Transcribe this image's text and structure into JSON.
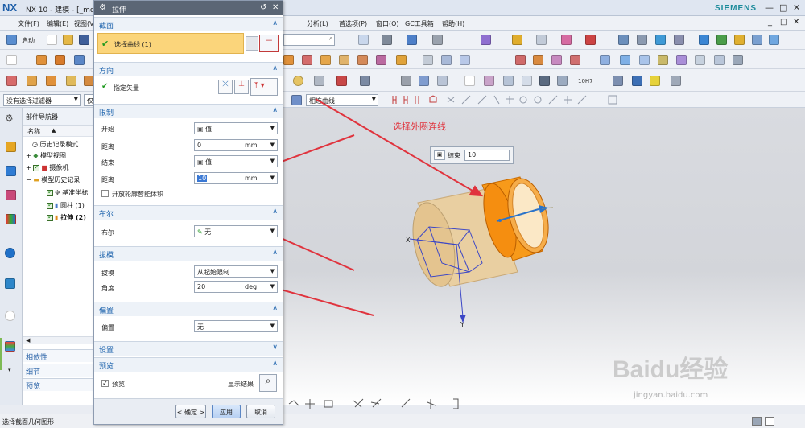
{
  "app": {
    "logo": "NX",
    "title": "NX 10 - 建模 - [_mc",
    "brand": "SIEMENS",
    "window_controls": [
      "—",
      "□",
      "✕"
    ]
  },
  "menubar": {
    "items": [
      "文件(F)",
      "编辑(E)",
      "视图(V)",
      "分析(L)",
      "首选项(P)",
      "窗口(O)",
      "GC工具箱",
      "帮助(H)"
    ],
    "right_controls": [
      "_",
      "□",
      "✕"
    ]
  },
  "toolbar": {
    "start_label": "启动",
    "filter_select": "没有选择过滤器",
    "filter_select2": "仅",
    "curve_rule": "相连曲线",
    "tool_10h7": "10H7"
  },
  "navigator": {
    "title": "部件导航器",
    "column_name": "名称",
    "items": [
      {
        "label": "历史记录模式"
      },
      {
        "label": "模型视图"
      },
      {
        "label": "摄像机"
      },
      {
        "label": "模型历史记录"
      },
      {
        "label": "基准坐标"
      },
      {
        "label": "圆柱 (1)"
      },
      {
        "label": "拉伸 (2)"
      }
    ],
    "sections": [
      "相依性",
      "细节",
      "预览"
    ]
  },
  "dialog": {
    "title": "拉伸",
    "title_controls": [
      "↺",
      "✕"
    ],
    "section_section": "截面",
    "select_curve": "选择曲线 (1)",
    "direction_section": "方向",
    "specify_vector": "指定矢量",
    "limits_section": "限制",
    "start_label": "开始",
    "start_value": "值",
    "distance_label": "距离",
    "start_distance": "0",
    "unit_mm": "mm",
    "end_label": "结束",
    "end_value": "值",
    "end_distance": "10",
    "open_profile": "开放轮廓智能体积",
    "boolean_section": "布尔",
    "boolean_label": "布尔",
    "boolean_value": "无",
    "draft_section": "拔模",
    "draft_label": "拔模",
    "draft_value": "从起始限制",
    "angle_label": "角度",
    "angle_value": "20",
    "unit_deg": "deg",
    "offset_section": "偏置",
    "offset_label": "偏置",
    "offset_value": "无",
    "settings_section": "设置",
    "preview_section": "预览",
    "preview_label": "预览",
    "show_result": "显示结果",
    "ok": "< 确定 >",
    "apply": "应用",
    "cancel": "取消"
  },
  "graphics": {
    "annotation": "选择外圈连线",
    "end_label": "结束",
    "end_value": "10",
    "axis_x": "X",
    "axis_y": "Y",
    "watermark_brand": "Baidu经验",
    "watermark_url": "jingyan.baidu.com"
  },
  "status": {
    "message": "选择截面几何图形"
  },
  "colors": {
    "accent_blue": "#1d63ad",
    "highlight_yellow": "#fbd57b",
    "annotation_red": "#e0333d",
    "solid_orange": "#f79a1a",
    "dialog_title": "#5b6675"
  }
}
